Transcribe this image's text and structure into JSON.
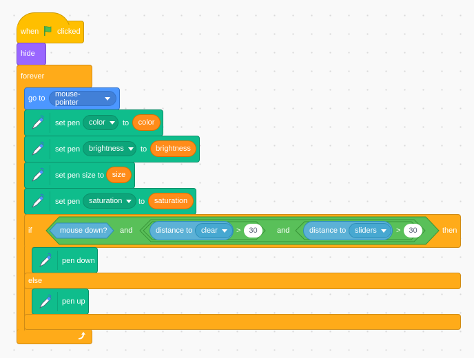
{
  "script": {
    "hat": {
      "when": "when",
      "icon": "green-flag-icon",
      "clicked": "clicked"
    },
    "hide": "hide",
    "forever": "forever",
    "goto": {
      "label": "go to",
      "target": "mouse-pointer"
    },
    "set_pen_color": {
      "label": "set pen",
      "param": "color",
      "to": "to",
      "value": "color"
    },
    "set_pen_brightness": {
      "label": "set pen",
      "param": "brightness",
      "to": "to",
      "value": "brightness"
    },
    "set_pen_size": {
      "label": "set pen size to",
      "value": "size"
    },
    "set_pen_saturation": {
      "label": "set pen",
      "param": "saturation",
      "to": "to",
      "value": "saturation"
    },
    "if_else": {
      "if": "if",
      "then": "then",
      "else": "else",
      "condition": {
        "mouse_down": "mouse down?",
        "and1": "and",
        "and2": "and",
        "dist1": {
          "label": "distance to",
          "target": "clear",
          "op": ">",
          "value": "30"
        },
        "dist2": {
          "label": "distance to",
          "target": "sliders",
          "op": ">",
          "value": "30"
        }
      },
      "then_block": "pen down",
      "else_block": "pen up"
    }
  },
  "colors": {
    "events": "#ffbf00",
    "looks": "#9966ff",
    "control": "#ffab19",
    "motion": "#4c97ff",
    "pen": "#0fbd8c",
    "operators": "#59c059",
    "sensing": "#5cb1d6",
    "variables": "#ff8c1a"
  }
}
